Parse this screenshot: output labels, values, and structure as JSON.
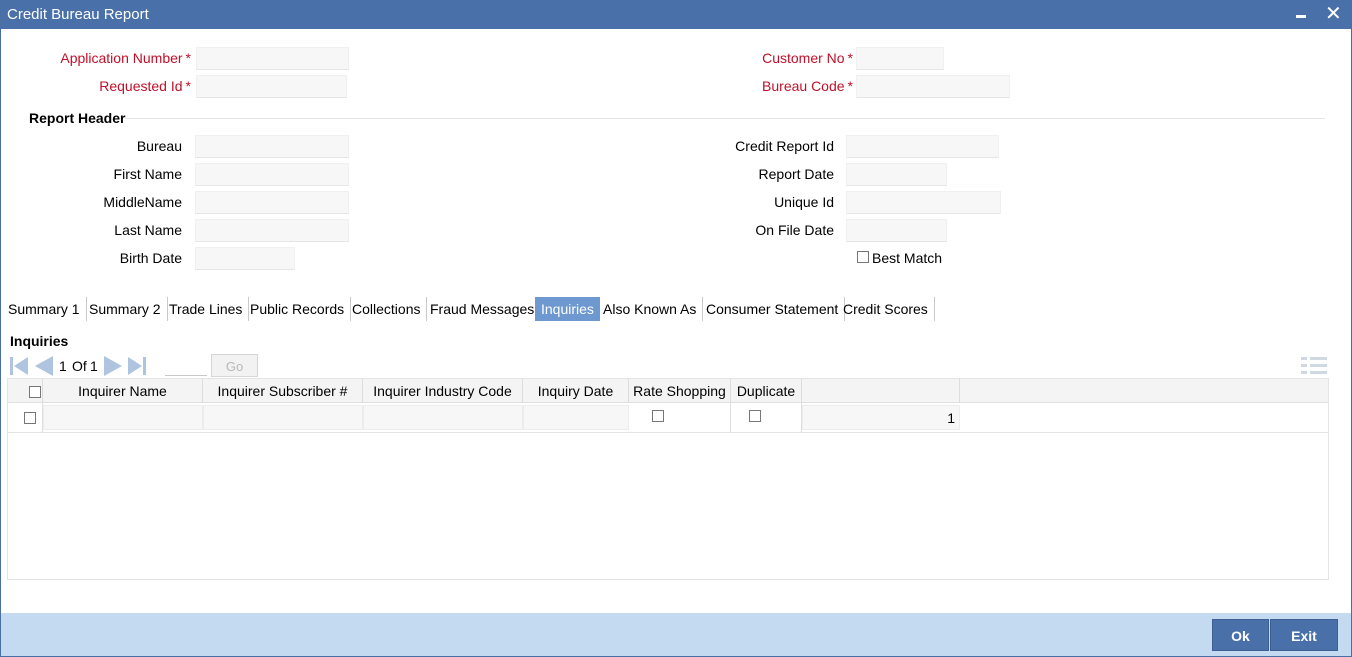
{
  "window": {
    "title": "Credit Bureau Report",
    "minimize": "▁",
    "close": "✕"
  },
  "form": {
    "application_number": {
      "label": "Application Number",
      "value": ""
    },
    "requested_id": {
      "label": "Requested Id",
      "value": ""
    },
    "customer_no": {
      "label": "Customer No",
      "value": ""
    },
    "bureau_code": {
      "label": "Bureau Code",
      "value": ""
    },
    "required_star": "*"
  },
  "report_header": {
    "title": "Report Header",
    "bureau": {
      "label": "Bureau",
      "value": ""
    },
    "first_name": {
      "label": "First Name",
      "value": ""
    },
    "middle_name": {
      "label": "MiddleName",
      "value": ""
    },
    "last_name": {
      "label": "Last Name",
      "value": ""
    },
    "birth_date": {
      "label": "Birth Date",
      "value": ""
    },
    "credit_report_id": {
      "label": "Credit Report Id",
      "value": ""
    },
    "report_date": {
      "label": "Report Date",
      "value": ""
    },
    "unique_id": {
      "label": "Unique Id",
      "value": ""
    },
    "on_file_date": {
      "label": "On File Date",
      "value": ""
    },
    "best_match": {
      "label": "Best Match",
      "checked": false
    }
  },
  "tabs": [
    {
      "label": "Summary 1"
    },
    {
      "label": "Summary 2"
    },
    {
      "label": "Trade Lines"
    },
    {
      "label": "Public Records"
    },
    {
      "label": "Collections"
    },
    {
      "label": "Fraud Messages"
    },
    {
      "label": "Inquiries",
      "active": true
    },
    {
      "label": "Also Known As"
    },
    {
      "label": "Consumer Statement"
    },
    {
      "label": "Credit Scores"
    }
  ],
  "inquiries": {
    "title": "Inquiries",
    "pager": {
      "current": "1",
      "of_label": "Of",
      "total": "1",
      "go_label": "Go",
      "goto_value": ""
    },
    "columns": [
      "Inquirer Name",
      "Inquirer Subscriber #",
      "Inquirer Industry Code",
      "Inquiry Date",
      "Rate Shopping",
      "Duplicate"
    ],
    "rows": [
      {
        "inquirer_name": "",
        "subscriber": "",
        "industry_code": "",
        "inquiry_date": "",
        "rate_shopping": false,
        "duplicate": false,
        "seq": "1"
      }
    ]
  },
  "footer": {
    "ok_label": "Ok",
    "exit_label": "Exit"
  },
  "colors": {
    "titlebar": "#4a70aa",
    "active_tab": "#6d98d0",
    "footer": "#c4daf0",
    "required": "#c0102a"
  }
}
